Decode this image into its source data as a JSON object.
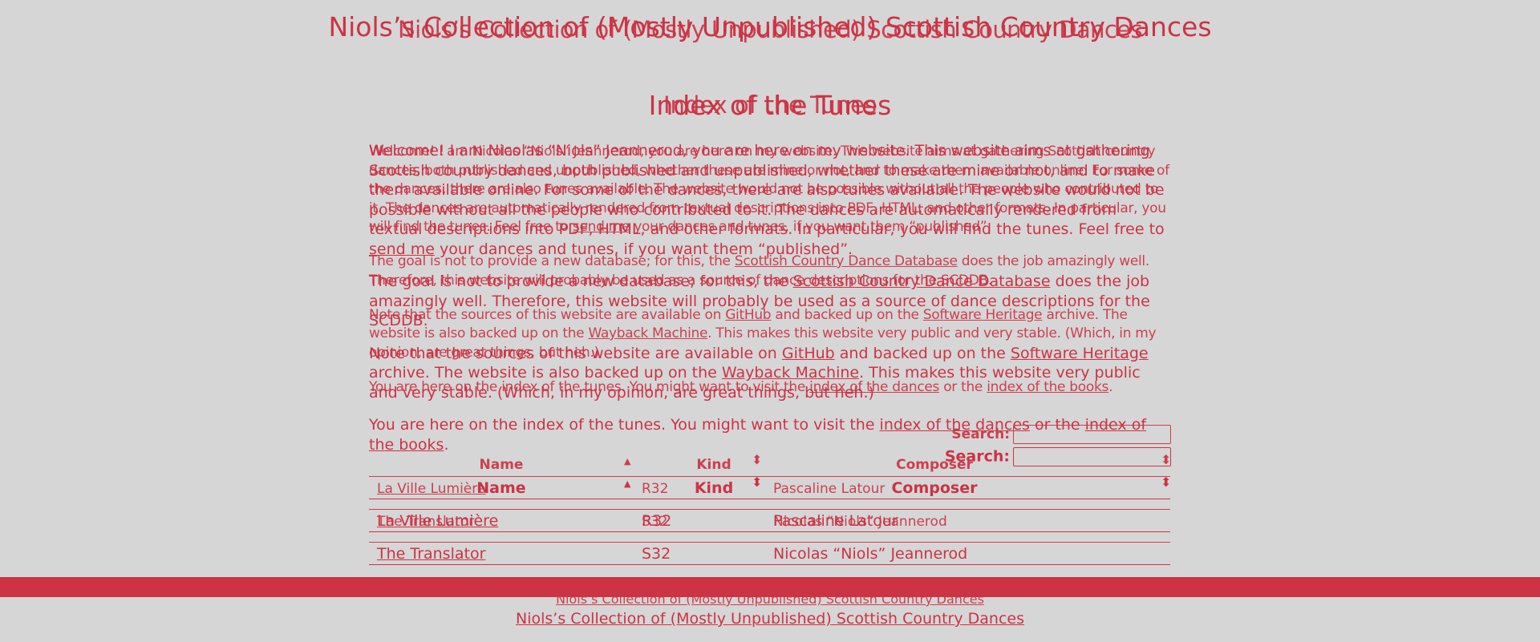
{
  "site": {
    "title": "Niols’s Collection of (Mostly Unpublished) Scottish Country Dances"
  },
  "page": {
    "title": "Index of the Tunes"
  },
  "intro": {
    "p1_a": "Welcome! I am Nicolas “Niols” Jeannerod, you are here on my website. This website aims at gathering Scottish country dances, both published and unpublished, whether these are mine or not, and to make them available online. For some of the dances, there are also tunes available. The website would not be possible without all the people who contributed to it. The dances are automatically rendered from textual descriptions into PDF, HTML, and other formats. In particular, you will find the tunes. Feel free to ",
    "p1_link": "send me",
    "p1_b": " your dances and tunes, if you want them “published”.",
    "p2_a": "The goal is not to provide a new database; for this, the ",
    "p2_link": "Scottish Country Dance Database",
    "p2_b": " does the job amazingly well. Therefore, this website will probably be used as a source of dance descriptions for the SCDDB.",
    "p3_a": "Note that the sources of this website are available on ",
    "p3_link1": "GitHub",
    "p3_mid": " and backed up on the ",
    "p3_link2": "Software Heritage",
    "p3_c": " archive. The website is also backed up on the ",
    "p3_link3": "Wayback Machine",
    "p3_d": ". This makes this website very public and very stable. (Which, in my opinion, are great things, but heh.)",
    "p4_a": "You are here on the index of the tunes. You might want to visit the ",
    "p4_link1": "index of the dances",
    "p4_mid": " or the ",
    "p4_link2": "index of the books",
    "p4_end": "."
  },
  "search": {
    "label": "Search:",
    "value": ""
  },
  "table": {
    "headers": [
      "Name",
      "Kind",
      "Composer"
    ],
    "sort_icon": "▲",
    "sort_icon_both": "⬍",
    "rows": [
      {
        "name": "La Ville Lumière",
        "kind": "R32",
        "composer": "Pascaline Latour"
      },
      {
        "name": "The Translator",
        "kind": "S32",
        "composer": "Nicolas “Niols” Jeannerod"
      }
    ]
  },
  "footer": {
    "link": "Niols’s Collection of (Mostly Unpublished) Scottish Country Dances"
  },
  "colors": {
    "accent": "#cc3344",
    "background": "#d6d6d6"
  }
}
